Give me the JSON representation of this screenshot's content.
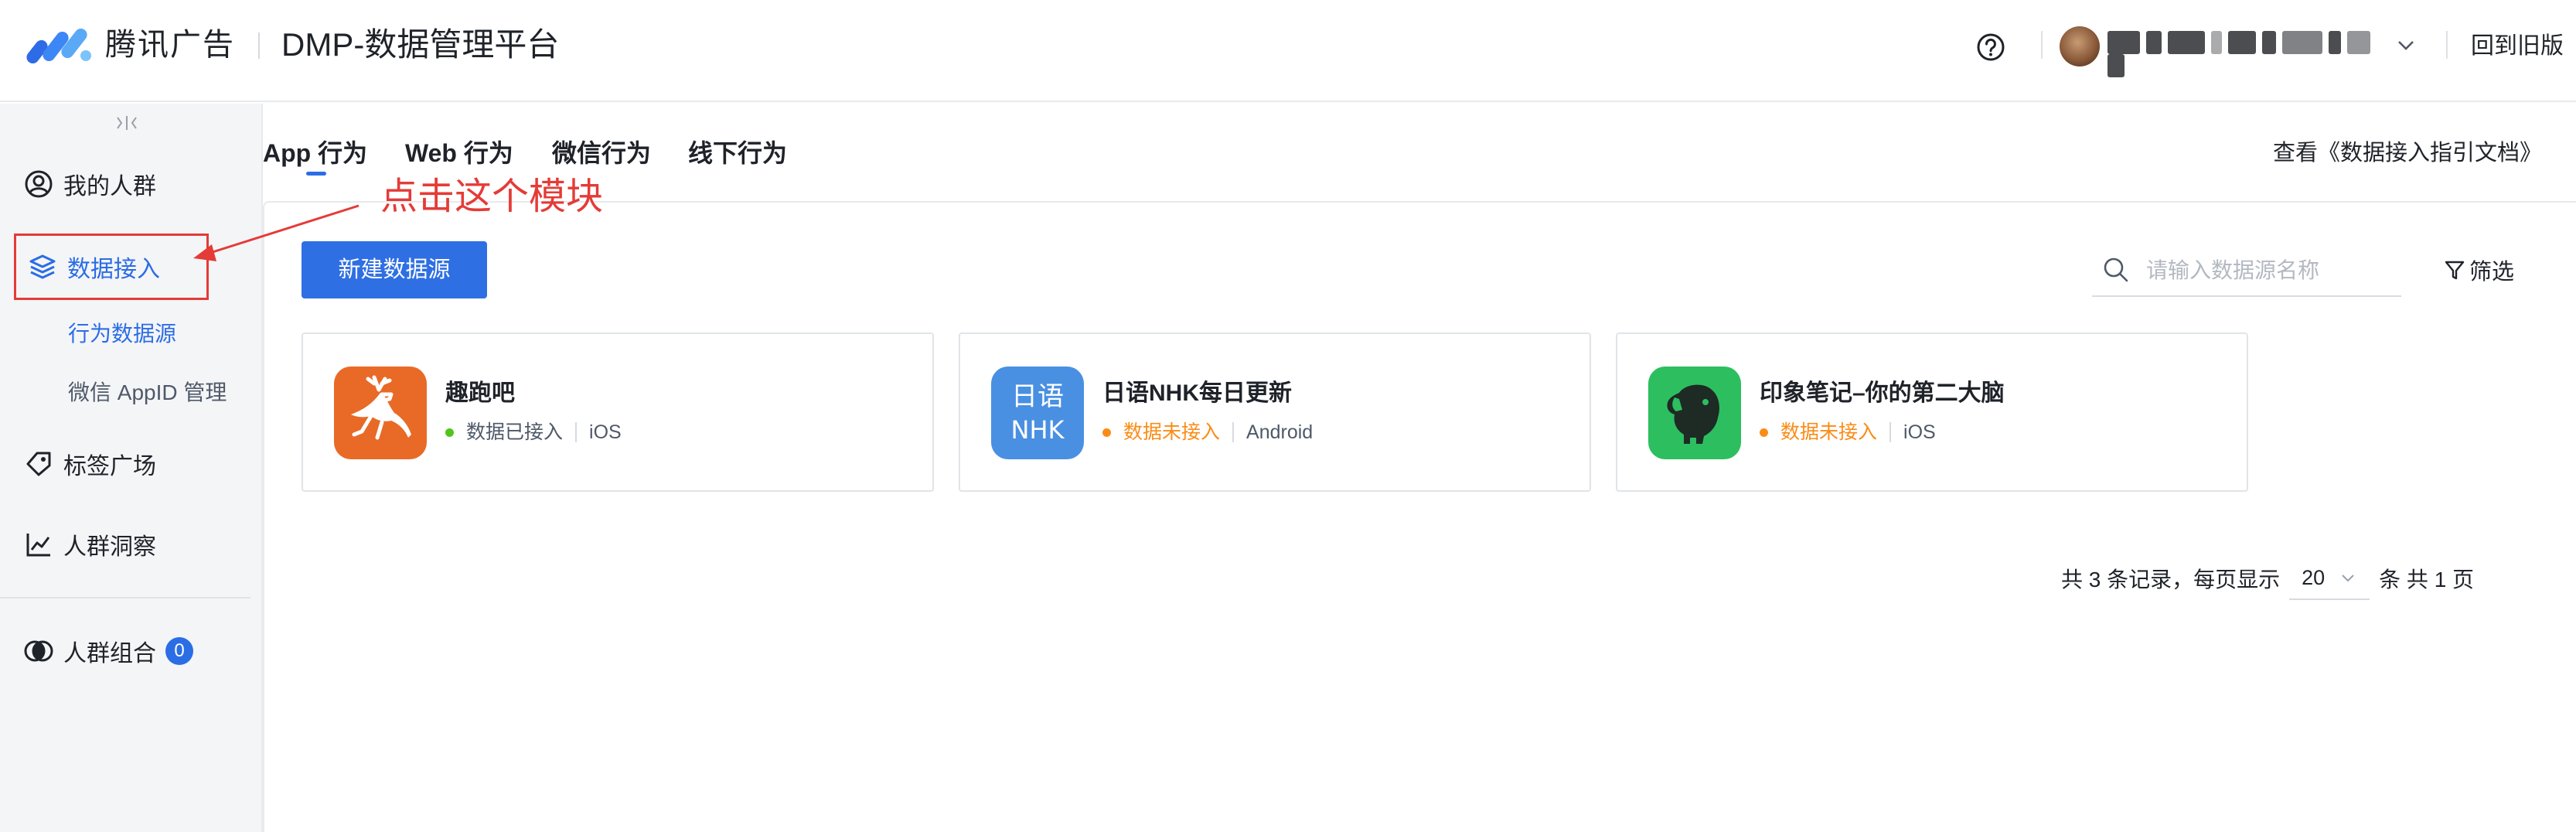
{
  "header": {
    "brand": "腾讯广告",
    "platform_title": "DMP-数据管理平台",
    "username": "redacted user name",
    "back_to_old": "回到旧版",
    "icons": [
      "brand-logo-icon",
      "help-icon",
      "chevron-down-icon"
    ]
  },
  "sidebar": {
    "items": [
      {
        "label": "我的人群",
        "icon": "user-circle-icon"
      },
      {
        "label": "数据接入",
        "icon": "layers-icon",
        "active": true
      },
      {
        "label": "标签广场",
        "icon": "tag-icon"
      },
      {
        "label": "人群洞察",
        "icon": "line-chart-icon"
      },
      {
        "label": "人群组合",
        "icon": "overlap-circles-icon",
        "badge": "0"
      }
    ],
    "sub_items": [
      {
        "label": "行为数据源",
        "active": true
      },
      {
        "label": "微信 AppID 管理"
      }
    ]
  },
  "tabs": {
    "items": [
      {
        "label": "App 行为",
        "active": true
      },
      {
        "label": "Web 行为"
      },
      {
        "label": "微信行为"
      },
      {
        "label": "线下行为"
      }
    ],
    "doc_link": "查看《数据接入指引文档》"
  },
  "toolbar": {
    "new_source_label": "新建数据源",
    "search_placeholder": "请输入数据源名称",
    "filter_label": "筛选"
  },
  "cards": [
    {
      "name": "趣跑吧",
      "status": "数据已接入",
      "status_color": "#52c41a",
      "platform": "iOS",
      "icon": "deer-app-icon",
      "icon_bg": "#e86a26"
    },
    {
      "name": "日语NHK每日更新",
      "status": "数据未接入",
      "status_color": "#fa8c16",
      "platform": "Android",
      "icon": "nhk-app-icon",
      "icon_bg": "#4a90e2",
      "icon_line1": "日语",
      "icon_line2": "NHK"
    },
    {
      "name": "印象笔记–你的第二大脑",
      "status": "数据未接入",
      "status_color": "#fa8c16",
      "platform": "iOS",
      "icon": "elephant-app-icon",
      "icon_bg": "#2dbe60"
    }
  ],
  "pagination": {
    "total_text": "共 3 条记录，每页显示",
    "page_size": "20",
    "suffix": "条 共 1 页"
  },
  "annotation": {
    "text": "点击这个模块",
    "color": "#e43b37"
  },
  "colors": {
    "accent": "#2b6de5",
    "primary_button": "#2f6fe4",
    "annotation_red": "#e43b37"
  }
}
